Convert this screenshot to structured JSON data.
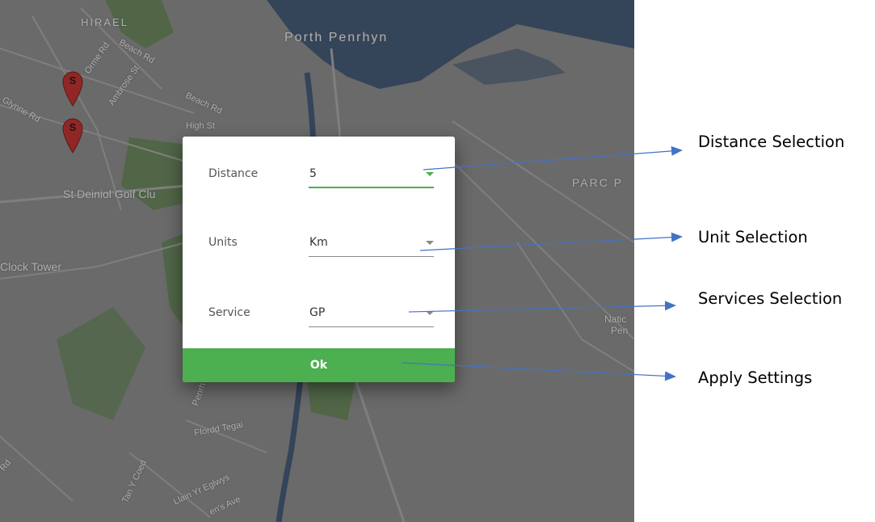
{
  "map": {
    "labels": {
      "hirael": "HIRAEL",
      "porth_penrhyn": "Porth Penrhyn",
      "parc": "PARC P",
      "golf_club": "St Deiniol Golf Clu",
      "clock_tower": "Clock Tower",
      "beach_rd_1": "Beach Rd",
      "beach_rd_2": "Beach Rd",
      "orme_rd": "Orme Rd",
      "ambrose_st": "Ambrose St",
      "glynne_rd": "Glynne Rd",
      "high_st": "High St",
      "natio_line1": "Natic",
      "natio_line2": "Pen",
      "ffordd_tegai": "Ffordd Tegai",
      "tan_y_coed": "Tan Y Coed",
      "llain_yr_eglwys": "Llain Yr Eglwys",
      "en_s_ave": "en's Ave",
      "penrh": "Penrh",
      "rd_corner": "Rd"
    },
    "markers": [
      "S",
      "S"
    ],
    "colors": {
      "land": "#7f7f7f",
      "water": "#3a4f6a",
      "park": "#5e7a52",
      "marker": "#b02a28"
    }
  },
  "dialog": {
    "fields": [
      {
        "label": "Distance",
        "value": "5"
      },
      {
        "label": "Units",
        "value": "Km"
      },
      {
        "label": "Service",
        "value": "GP"
      }
    ],
    "ok_label": "Ok",
    "accent_color": "#4caf50"
  },
  "callouts": {
    "distance": "Distance Selection",
    "units": "Unit Selection",
    "services": "Services Selection",
    "apply": "Apply Settings"
  },
  "arrow_color": "#4472c4"
}
